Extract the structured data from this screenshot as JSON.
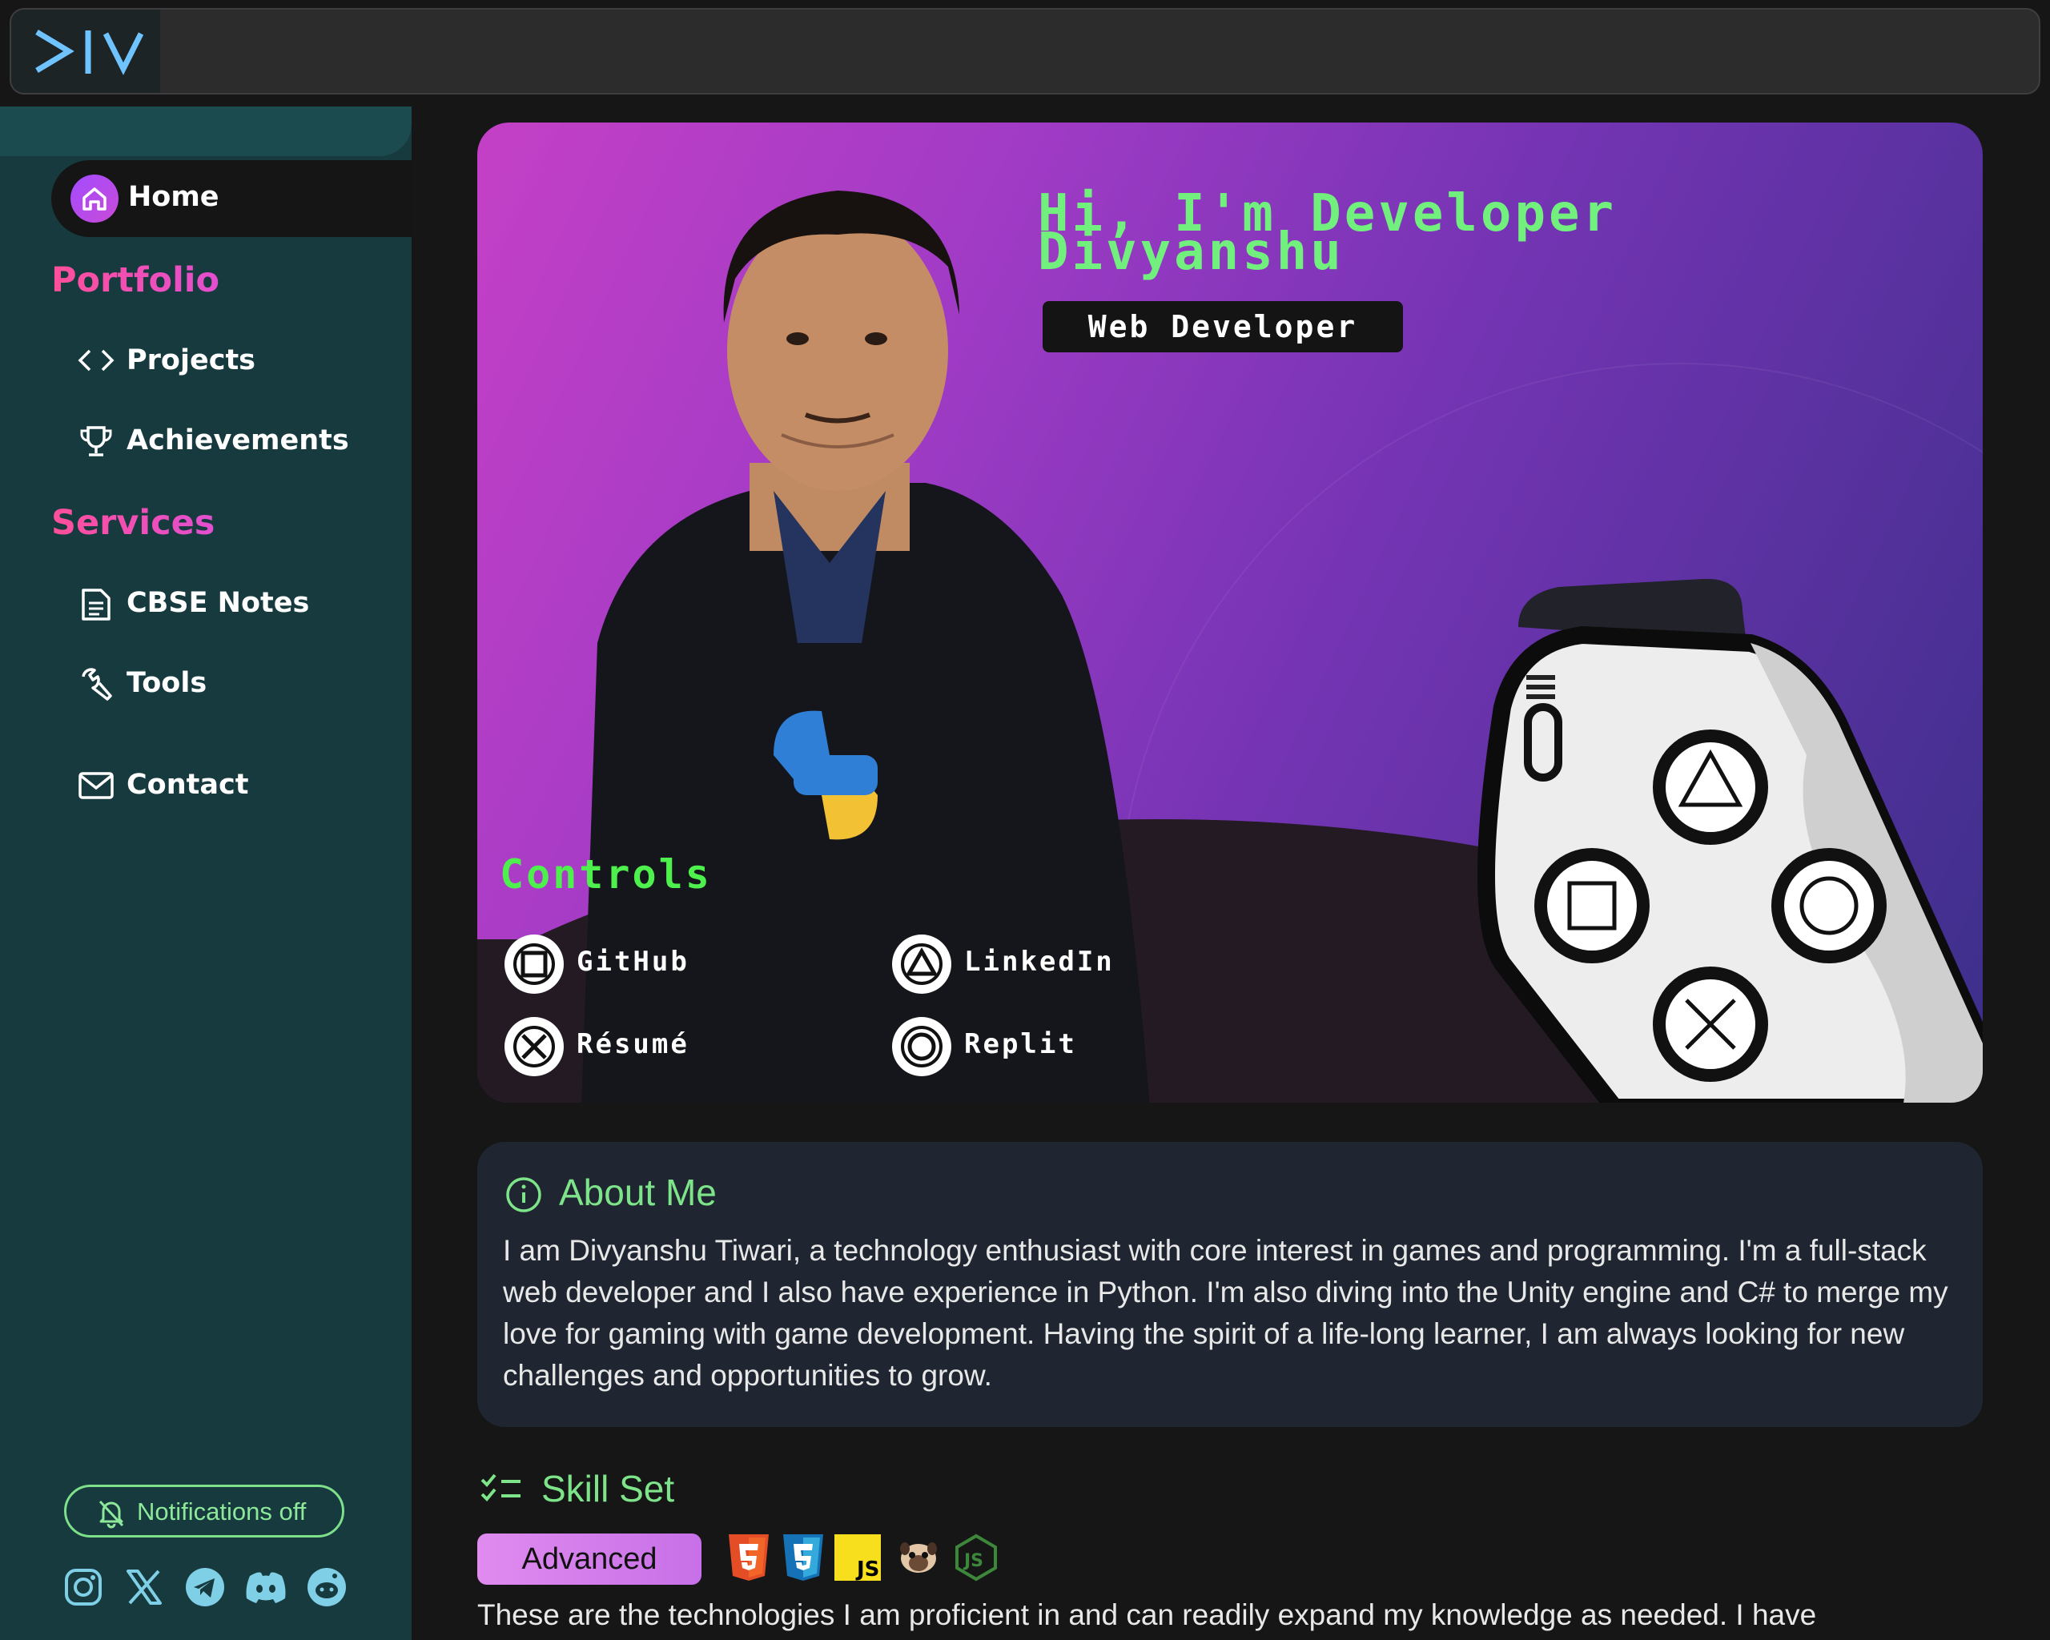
{
  "nav": {
    "home": "Home",
    "portfolio_heading": "Portfolio",
    "projects": "Projects",
    "achievements": "Achievements",
    "services_heading": "Services",
    "cbse_notes": "CBSE Notes",
    "tools": "Tools",
    "contact": "Contact",
    "notifications": "Notifications off"
  },
  "social_icons": [
    "instagram-icon",
    "x-icon",
    "telegram-icon",
    "discord-icon",
    "reddit-icon"
  ],
  "hero": {
    "title_line1": "Hi, I'm Developer",
    "title_line2": "Divyanshu",
    "role": "Web Developer",
    "controls_title": "Controls",
    "controls": [
      {
        "label": "GitHub",
        "icon": "square-button-icon"
      },
      {
        "label": "LinkedIn",
        "icon": "triangle-button-icon"
      },
      {
        "label": "Résumé",
        "icon": "cross-button-icon"
      },
      {
        "label": "Replit",
        "icon": "circle-button-icon"
      }
    ]
  },
  "about": {
    "title": "About Me",
    "text": "I am Divyanshu Tiwari, a technology enthusiast with core interest in games and programming. I'm a full-stack web developer and I also have experience in Python. I'm also diving into the Unity engine and C# to merge my love for gaming with game development. Having the spirit of a life-long learner, I am always looking for new challenges and opportunities to grow."
  },
  "skills": {
    "title": "Skill Set",
    "level": "Advanced",
    "tech_icons": [
      "html5-icon",
      "css3-icon",
      "javascript-icon",
      "pug-icon",
      "nodejs-icon"
    ],
    "text": "These are the technologies I am proficient in and can readily expand my knowledge as needed. I have"
  },
  "colors": {
    "accent_green": "#7ee48a",
    "section_pink": "#ff4f9a",
    "sidebar_bg": "#163a3e",
    "hero_gradient_start": "#c440c6",
    "hero_gradient_end": "#3c2f8a"
  }
}
